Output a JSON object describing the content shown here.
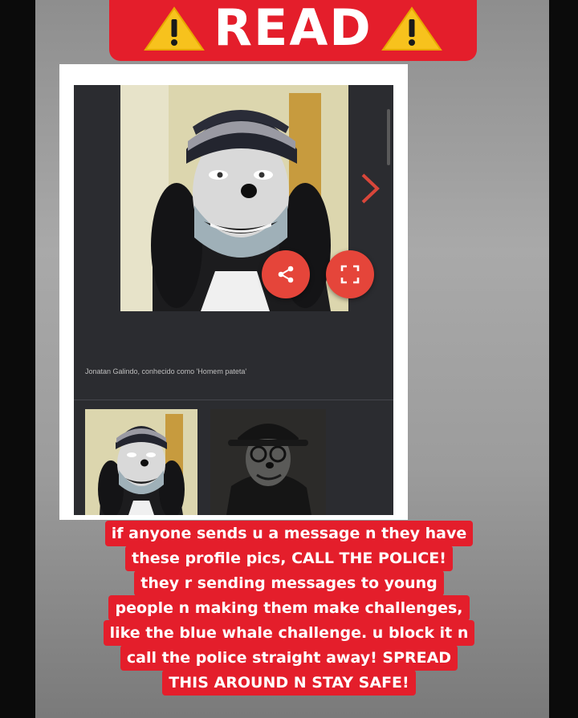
{
  "banner": {
    "title": "READ",
    "icon_left": "warning-icon",
    "icon_right": "warning-icon",
    "color": "#e41e2b"
  },
  "screenshot": {
    "caption": "Jonatan Galindo, conhecido como 'Homem pateta'",
    "icons": {
      "next": "chevron-right-icon",
      "share": "share-icon",
      "expand": "fullscreen-icon"
    },
    "accent": "#e5453a"
  },
  "message": {
    "lines": [
      "if anyone sends u a message n they have",
      "these profile pics, CALL THE POLICE!",
      "they r sending messages to young",
      "people n making them make challenges,",
      "like the blue whale challenge. u block it n",
      "call the police straight away! SPREAD",
      "THIS AROUND N STAY SAFE!"
    ]
  }
}
